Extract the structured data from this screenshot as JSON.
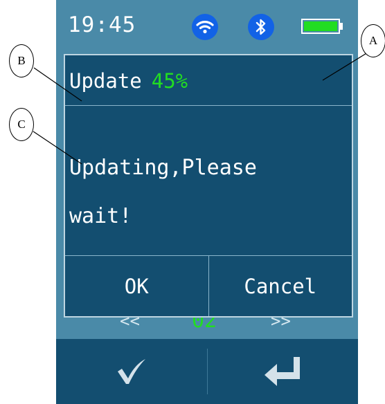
{
  "status_bar": {
    "time": "19:45",
    "battery_level": 1.0,
    "icons": [
      "wifi-icon",
      "bluetooth-icon",
      "battery-icon"
    ]
  },
  "background": {
    "prev_label": "<<",
    "page": "02",
    "next_label": ">>"
  },
  "dialog": {
    "title": "Update",
    "progress_text": "45%",
    "message_line1": "Updating,Please",
    "message_line2": "wait!",
    "ok_label": "OK",
    "cancel_label": "Cancel"
  },
  "bottom_bar": {
    "icons": [
      "checkmark-icon",
      "enter-icon"
    ]
  },
  "callouts": {
    "a": "A",
    "b": "B",
    "c": "C"
  },
  "colors": {
    "screen_bg": "#4a8aa8",
    "dialog_bg": "#134e70",
    "accent_green": "#22dd22",
    "status_icon_blue": "#1262e6"
  }
}
